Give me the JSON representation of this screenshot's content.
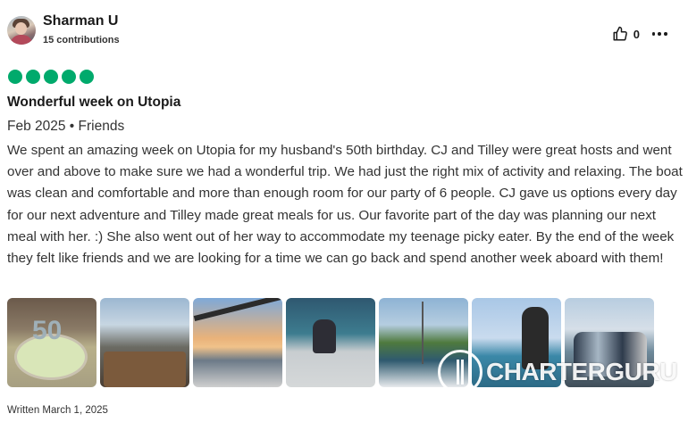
{
  "review": {
    "user": {
      "name": "Sharman U",
      "contributions": "15 contributions"
    },
    "likes": "0",
    "rating": 5,
    "title": "Wonderful week on Utopia",
    "meta": "Feb 2025 • Friends",
    "body": "We spent an amazing week on Utopia for my husband's 50th birthday. CJ and Tilley were great hosts and went over and above to make sure we had a wonderful trip. We had just the right mix of activity and relaxing. The boat was clean and comfortable and more than enough room for our party of 6 people. CJ gave us options every day for our next adventure and Tilley made great meals for us. Our favorite part of the day was planning our next meal with her. :) She also went out of her way to accommodate my teenage picky eater. By the end of the week they felt like friends and we are looking for a time we can go back and spend another week aboard with them!",
    "photo_cake_text": "50",
    "written": "Written March 1, 2025"
  },
  "watermark": {
    "text": "CHARTERGURU"
  },
  "icons": {
    "like": "thumbs-up-icon",
    "more": "more-options-icon",
    "rating": "rating-bubble-icon"
  },
  "colors": {
    "rating_green": "#00aa6c",
    "text_dark": "#1a1a1a",
    "text": "#333333"
  }
}
